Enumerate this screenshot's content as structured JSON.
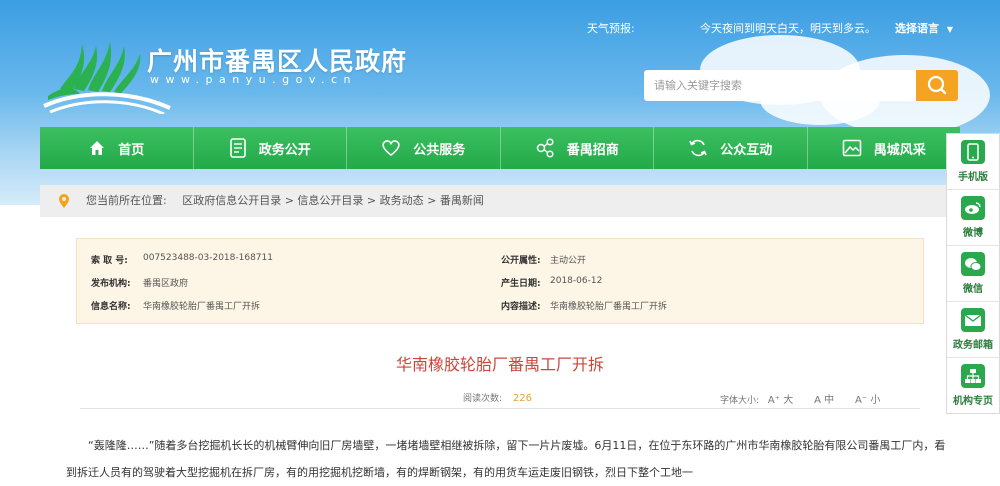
{
  "header": {
    "site_title": "广州市番禺区人民政府",
    "site_url": "www.panyu.gov.cn",
    "weather_label": "天气预报:",
    "weather_text": "今天夜间到明天白天，明天到多云。",
    "language_label": "选择语言",
    "search_placeholder": "请输入关键字搜索"
  },
  "nav": [
    {
      "label": "首页",
      "icon": "home-icon"
    },
    {
      "label": "政务公开",
      "icon": "document-icon"
    },
    {
      "label": "公共服务",
      "icon": "heart-icon"
    },
    {
      "label": "番禺招商",
      "icon": "network-icon"
    },
    {
      "label": "公众互动",
      "icon": "refresh-icon"
    },
    {
      "label": "禺城风采",
      "icon": "picture-icon"
    }
  ],
  "side": [
    {
      "label": "手机版",
      "icon": "phone-icon"
    },
    {
      "label": "微博",
      "icon": "weibo-icon"
    },
    {
      "label": "微信",
      "icon": "wechat-icon"
    },
    {
      "label": "政务邮箱",
      "icon": "mail-icon"
    },
    {
      "label": "机构专页",
      "icon": "org-chart-icon"
    }
  ],
  "breadcrumb": {
    "prefix": "您当前所在位置:",
    "path": "区政府信息公开目录 > 信息公开目录 > 政务动态 > 番禺新闻"
  },
  "info": {
    "index_label": "索 取 号:",
    "index_value": "007523488-03-2018-168711",
    "open_label": "公开属性:",
    "open_value": "主动公开",
    "publisher_label": "发布机构:",
    "publisher_value": "番禺区政府",
    "date_label": "产生日期:",
    "date_value": "2018-06-12",
    "name_label": "信息名称:",
    "name_value": "华南橡胶轮胎厂番禺工厂开拆",
    "desc_label": "内容描述:",
    "desc_value": "华南橡胶轮胎厂番禺工厂开拆"
  },
  "article": {
    "title": "华南橡胶轮胎厂番禺工厂开拆",
    "read_label": "阅读次数:",
    "read_count": "226",
    "font_label": "字体大小:",
    "font_large": "A⁺ 大",
    "font_medium": "A 中",
    "font_small": "A⁻ 小",
    "paragraph": "“轰隆隆……”随着多台挖掘机长长的机械臂伸向旧厂房墙壁，一堵堵墙壁相继被拆除，留下一片片废墟。6月11日，在位于东环路的广州市华南橡胶轮胎有限公司番禺工厂内，看到拆迁人员有的驾驶着大型挖掘机在拆厂房，有的用挖掘机挖断墙，有的焊断钢架，有的用货车运走废旧钢铁，烈日下整个工地一"
  },
  "colors": {
    "nav_green": "#2bb14f",
    "title_red": "#c9473b",
    "search_orange": "#f5a323",
    "read_count_orange": "#e9a13b"
  }
}
